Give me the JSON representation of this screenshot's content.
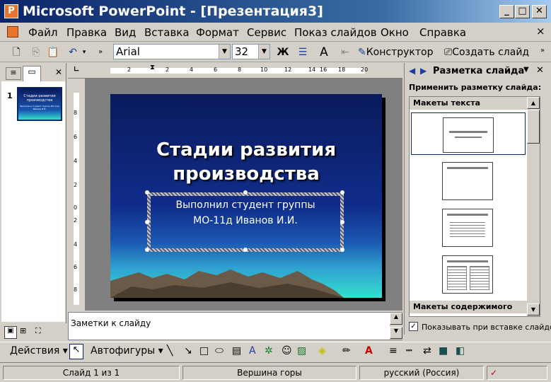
{
  "window": {
    "title": "Microsoft PowerPoint - [Презентация3]",
    "app_icon": "powerpoint-icon"
  },
  "menu": [
    "Файл",
    "Правка",
    "Вид",
    "Вставка",
    "Формат",
    "Сервис",
    "Показ слайдов",
    "Окно",
    "Справка"
  ],
  "toolbar": {
    "font": "Arial",
    "size": "32",
    "bold": "Ж",
    "designer": "Конструктор",
    "new_slide": "Создать слайд"
  },
  "ruler": {
    "h_ticks": [
      "2",
      "2",
      "4",
      "6",
      "8",
      "10",
      "12",
      "14",
      "16",
      "18",
      "20"
    ],
    "v_ticks": [
      "8",
      "6",
      "4",
      "2",
      "0",
      "2",
      "4",
      "6",
      "8"
    ]
  },
  "thumbnails": {
    "num": "1",
    "title": "Стадии развития производства",
    "subtitle": "Выполнил студент группы МО-11д Иванов И.И."
  },
  "slide": {
    "title_line1": "Стадии развития",
    "title_line2": "производства",
    "subtitle_line1": "Выполнил студент группы",
    "subtitle_line2": "МО-11д Иванов И.И."
  },
  "taskpane": {
    "title": "Разметка слайда",
    "apply_label": "Применить разметку слайда:",
    "section_text": "Макеты текста",
    "section_content": "Макеты содержимого",
    "show_on_insert": "Показывать при вставке слайдов"
  },
  "notes": {
    "placeholder": "Заметки к слайду"
  },
  "draw": {
    "actions": "Действия",
    "autoshapes": "Автофигуры"
  },
  "status": {
    "slide": "Слайд 1 из 1",
    "design": "Вершина горы",
    "lang": "русский (Россия)"
  },
  "colors": {
    "title_bar": "#0a246a",
    "slide_top": "#0a1a5c",
    "slide_bottom": "#34e0d0",
    "mountains": "#6b5a48"
  }
}
